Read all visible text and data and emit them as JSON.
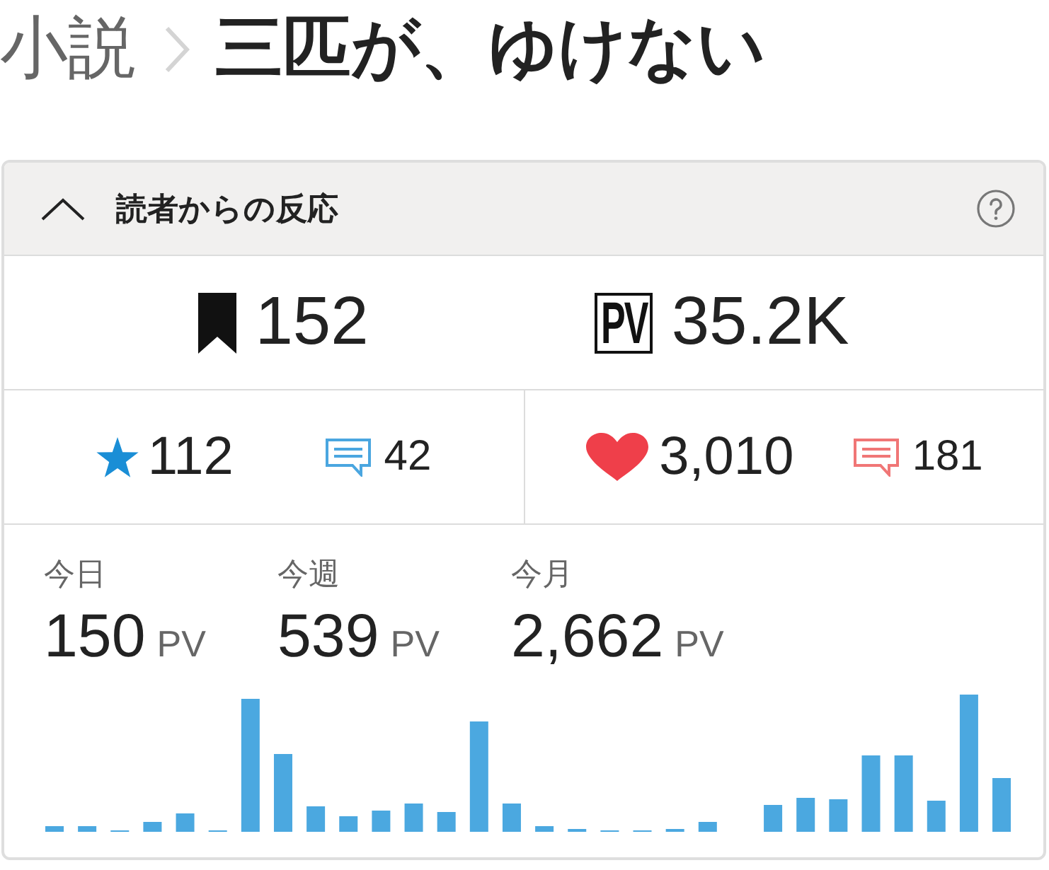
{
  "breadcrumb": {
    "parent": "小説",
    "title": "三匹が、ゆけない"
  },
  "panel": {
    "title": "読者からの反応",
    "expanded": true,
    "summary": [
      {
        "kind": "bookmarks",
        "value": "152"
      },
      {
        "kind": "pageviews",
        "badge": "PV",
        "value": "35.2K"
      }
    ],
    "reactions": [
      {
        "kind": "stars",
        "count": "112",
        "comments": "42"
      },
      {
        "kind": "hearts",
        "count": "3,010",
        "comments": "181"
      }
    ],
    "periods": [
      {
        "label": "今日",
        "value": "150",
        "unit": "PV"
      },
      {
        "label": "今週",
        "value": "539",
        "unit": "PV"
      },
      {
        "label": "今月",
        "value": "2,662",
        "unit": "PV"
      }
    ]
  }
}
